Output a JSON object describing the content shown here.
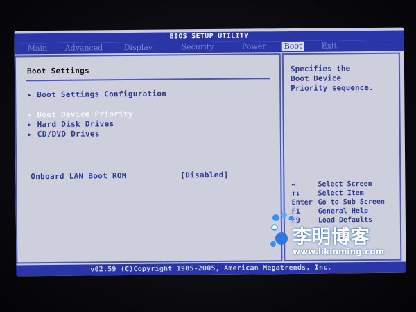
{
  "window": {
    "title": "BIOS SETUP UTILITY"
  },
  "menu": {
    "tabs": [
      {
        "label": "Main"
      },
      {
        "label": "Advanced"
      },
      {
        "label": "Display"
      },
      {
        "label": "Security"
      },
      {
        "label": "Power"
      },
      {
        "label": "Boot"
      },
      {
        "label": "Exit"
      }
    ],
    "active": "Boot"
  },
  "main": {
    "section_title": "Boot Settings",
    "items": [
      {
        "label": "Boot Settings Configuration"
      },
      {
        "label": "Boot Device Priority",
        "selected": true
      },
      {
        "label": "Hard Disk Drives"
      },
      {
        "label": "CD/DVD Drives"
      }
    ],
    "option": {
      "label": "Onboard LAN Boot ROM",
      "value": "[Disabled]"
    }
  },
  "help": {
    "lines": [
      "Specifies the",
      "Boot Device",
      "Priority sequence."
    ],
    "keys": [
      {
        "key": "↔",
        "desc": "Select Screen"
      },
      {
        "key": "↑↓",
        "desc": "Select Item"
      },
      {
        "key": "Enter",
        "desc": "Go to Sub Screen"
      },
      {
        "key": "F1",
        "desc": "General Help"
      },
      {
        "key": "F9",
        "desc": "Load Defaults"
      }
    ]
  },
  "footer": {
    "text": "v02.59 (C)Copyright 1985-2005, American Megatrends, Inc."
  },
  "watermark": {
    "text": "李明博客",
    "url": "www.likinming.com"
  },
  "colors": {
    "bar": "#2a35a8",
    "panel": "#cdd0dc",
    "text": "#2e3a9c",
    "highlight": "#f4f5fb"
  },
  "icons": {
    "item_arrow": "triangle-right-icon"
  }
}
